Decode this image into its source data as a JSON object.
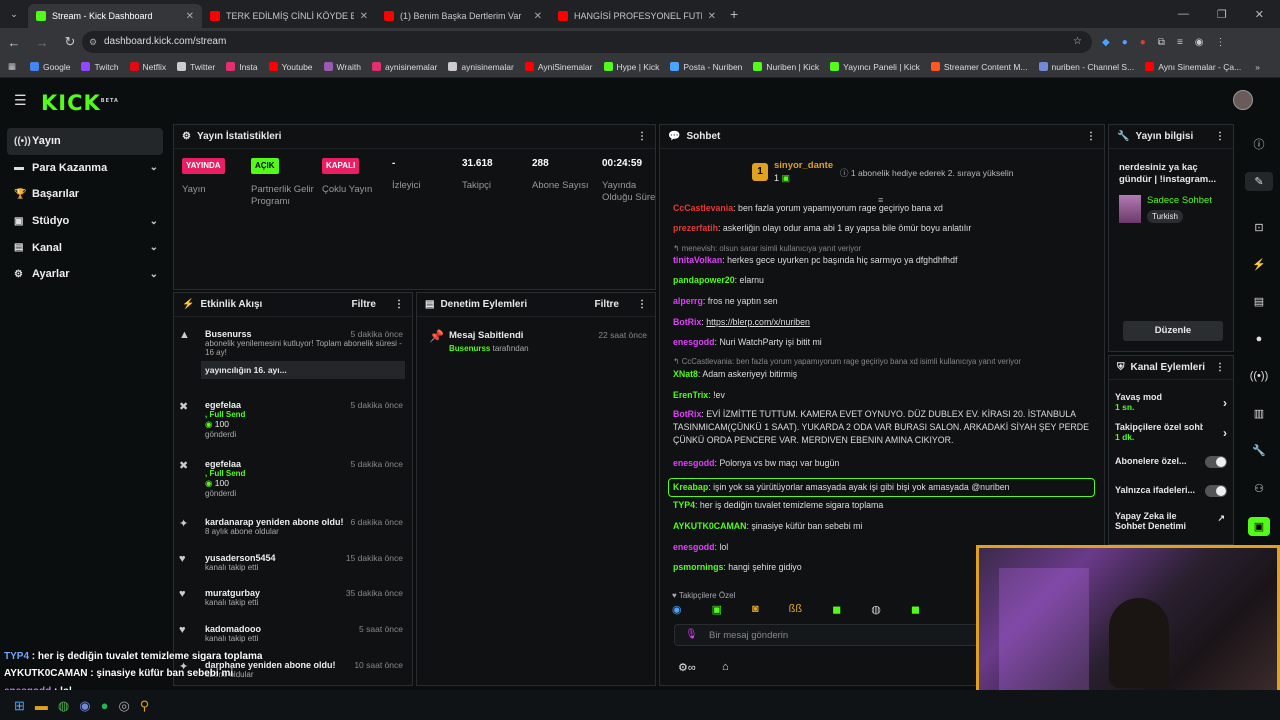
{
  "browser": {
    "tabs": [
      {
        "title": "Stream - Kick Dashboard",
        "active": true,
        "color": "#53fc18"
      },
      {
        "title": "TERK EDİLMİŞ CİNLİ KÖYDE BİR",
        "active": false,
        "color": "#ff0000"
      },
      {
        "title": "(1) Benim Başka Dertlerim Var",
        "active": false,
        "color": "#ff0000"
      },
      {
        "title": "HANGİSİ PROFESYONEL FUTBO",
        "active": false,
        "color": "#ff0000"
      }
    ],
    "url": "dashboard.kick.com/stream",
    "bookmarks": [
      "Google",
      "Twitch",
      "Netflix",
      "Twitter",
      "Insta",
      "Youtube",
      "Wraith",
      "aynisinemalar",
      "aynisinemalar",
      "AyniSinemalar",
      "Hype | Kick",
      "Posta - Nuriben",
      "Nuriben | Kick",
      "Yayıncı Paneli | Kick",
      "Streamer Content M...",
      "nuriben - Channel S...",
      "Aynı Sinemalar - Ça..."
    ]
  },
  "logo": "KICK",
  "logo_sup": "BETA",
  "sidebar": [
    {
      "label": "Yayın",
      "icon": "broadcast-icon",
      "active": true,
      "chevron": false
    },
    {
      "label": "Para Kazanma",
      "icon": "money-icon",
      "active": false,
      "chevron": true
    },
    {
      "label": "Başarılar",
      "icon": "trophy-icon",
      "active": false,
      "chevron": false
    },
    {
      "label": "Stüdyo",
      "icon": "studio-icon",
      "active": false,
      "chevron": true
    },
    {
      "label": "Kanal",
      "icon": "channel-icon",
      "active": false,
      "chevron": true
    },
    {
      "label": "Ayarlar",
      "icon": "gear-icon",
      "active": false,
      "chevron": true
    }
  ],
  "stats": {
    "title": "Yayın İstatistikleri",
    "items": [
      {
        "badge": "YAYINDA",
        "badge_color": "#e91e63",
        "label": "Yayın"
      },
      {
        "badge": "AÇIK",
        "badge_color": "#53fc18",
        "label": "Partnerlik Gelir Programı"
      },
      {
        "badge": "KAPALI",
        "badge_color": "#e91e63",
        "label": "Çoklu Yayın"
      },
      {
        "value": "-",
        "label": "İzleyici"
      },
      {
        "value": "31.618",
        "label": "Takipçi"
      },
      {
        "value": "288",
        "label": "Abone Sayısı"
      },
      {
        "value": "00:24:59",
        "label": "Yayında Olduğu Süre"
      }
    ]
  },
  "activity": {
    "title": "Etkinlik Akışı",
    "filter": "Filtre",
    "events": [
      {
        "name": "Busenurss",
        "time": "5 dakika önce",
        "desc": "abonelik yenilemesini kutluyor! Toplam abonelik süresi - 16 ay!",
        "msg": "yayıncılığın 16. ayı..."
      },
      {
        "name": "egefelaa",
        "time": "5 dakika önce",
        "desc": ", Full Send",
        "amount": "100",
        "sub": "gönderdi"
      },
      {
        "name": "egefelaa",
        "time": "5 dakika önce",
        "desc": ", Full Send",
        "amount": "100",
        "sub": "gönderdi"
      },
      {
        "name": "kardanarap yeniden abone oldu!",
        "time": "6 dakika önce",
        "desc": "8 aylık abone oldular"
      },
      {
        "name": "yusaderson5454",
        "time": "15 dakika önce",
        "desc": "kanalı takip etti"
      },
      {
        "name": "muratgurbay",
        "time": "35 dakika önce",
        "desc": "kanalı takip etti"
      },
      {
        "name": "kadomadooo",
        "time": "5 saat önce",
        "desc": "kanalı takip etti"
      },
      {
        "name": "darphane yeniden abone oldu!",
        "time": "10 saat önce",
        "desc": "abone oldular"
      }
    ]
  },
  "moderation": {
    "title": "Denetim Eylemleri",
    "filter": "Filtre",
    "items": [
      {
        "title": "Mesaj Sabitlendi",
        "time": "22 saat önce",
        "user": "Busenurss",
        "suffix": "tarafından"
      }
    ]
  },
  "chat": {
    "title": "Sohbet",
    "top_gifter": "sinyor_dante",
    "gift_count": "1",
    "rank": "1",
    "pinned_hint": "1 abonelik hediye ederek 2. sıraya yükselin",
    "messages": [
      {
        "user": "CcCastlevania",
        "color": "#e53935",
        "text": "ben fazla yorum yapamıyorum rage geçiriyo bana xd"
      },
      {
        "user": "prezerfatih",
        "color": "#e53935",
        "text": "askerliğin olayı odur ama abi 1 ay yapsa bile ömür boyu anlatılır"
      },
      {
        "reply": "menevish: olsun sarar isimli kullanıcıya yanıt veriyor"
      },
      {
        "user": "tinitaVolkan",
        "color": "#e040fb",
        "text": "herkes gece uyurken pc başında hiç sarmıyo ya dfghdhfhdf"
      },
      {
        "user": "pandapower20",
        "color": "#53fc18",
        "text": "elarnu"
      },
      {
        "user": "alperrg",
        "color": "#e040fb",
        "text": "fros ne yaptın sen"
      },
      {
        "user": "BotRix",
        "color": "#e040fb",
        "text": "https://blerp.com/x/nuriben"
      },
      {
        "user": "enesgodd",
        "color": "#e040fb",
        "text": "Nuri WatchParty işi bitit mi"
      },
      {
        "reply": "CcCastlevania: ben fazla yorum yapamıyorum rage geçiriyo bana xd isimli kullanıcıya yanıt veriyor"
      },
      {
        "user": "XNat8",
        "color": "#53fc18",
        "text": "Adam askeriyeyi bitirmiş"
      },
      {
        "user": "ErenTrix",
        "color": "#53fc18",
        "text": "!ev"
      },
      {
        "user": "BotRix",
        "color": "#e040fb",
        "text": "EVİ İZMİTTE TUTTUM. KAMERA EVET OYNUYO. DÜZ DUBLEX EV. KİRASI 20. İSTANBULA TASINMICAM(ÇÜNKÜ 1 SAAT). YUKARDA 2 ODA VAR BURASI SALON. ARKADAKİ SİYAH ŞEY PERDE ÇÜNKÜ ORDA PENCERE VAR. MERDIVEN EBENIN AMINA CIKIYOR."
      },
      {
        "user": "enesgodd",
        "color": "#e040fb",
        "text": "Polonya vs bw maçı var bugün"
      },
      {
        "user": "Kreabap",
        "color": "#53fc18",
        "text": "işin yok sa yürütüyorlar amasyada ayak işi gibi bişi yok amasyada @nuriben"
      },
      {
        "user": "TYP4",
        "color": "#53fc18",
        "text": "her iş dediğin tuvalet temizleme sigara toplama"
      },
      {
        "user": "AYKUTK0CAMAN",
        "color": "#53fc18",
        "text": "şinasiye küfür ban sebebi mi"
      },
      {
        "user": "enesgodd",
        "color": "#e040fb",
        "text": "lol"
      },
      {
        "user": "psmornings",
        "color": "#53fc18",
        "text": "hangi şehire gidiyo"
      }
    ],
    "followers_only": "Takipçilere Özel",
    "input_placeholder": "Bir mesaj gönderin"
  },
  "info": {
    "title": "Yayın bilgisi",
    "stream_title": "nerdesiniz ya kaç gündür | !instagram...",
    "category": "Sadece Sohbet",
    "tag": "Turkish",
    "edit": "Düzenle"
  },
  "channel_actions": {
    "title": "Kanal Eylemleri",
    "items": [
      {
        "label": "Yavaş mod",
        "value": "1 sn.",
        "type": "chevron"
      },
      {
        "label": "Takipçilere özel sohbet",
        "value": "1 dk.",
        "type": "chevron"
      },
      {
        "label": "Abonelere özel...",
        "type": "toggle"
      },
      {
        "label": "Yalnızca ifadeleri...",
        "type": "toggle"
      },
      {
        "label": "Yapay Zeka ile Sohbet Denetimi",
        "type": "link"
      }
    ]
  },
  "overlay_chat": [
    {
      "user": "TYP4",
      "color": "#6fa8ff",
      "text": "her iş dediğin tuvalet temizleme sigara toplama"
    },
    {
      "user": "AYKUTK0CAMAN",
      "color": "#ffffff",
      "text": "şinasiye küfür ban sebebi mi"
    },
    {
      "user": "enesgodd",
      "color": "#c77dff",
      "text": "lol"
    },
    {
      "user": "psmornings",
      "color": "#4dd0e1",
      "text": "hangi şehire gidiyo"
    }
  ]
}
